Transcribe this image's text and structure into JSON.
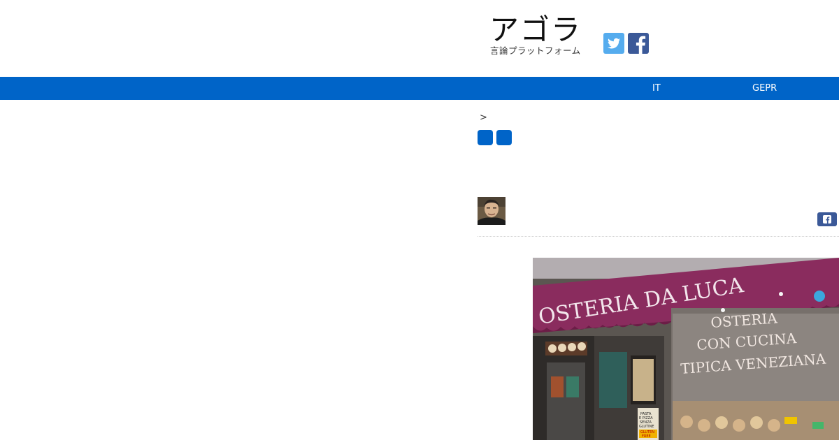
{
  "header": {
    "logo_title": "アゴラ",
    "logo_subtitle": "言論プラットフォーム",
    "social": [
      {
        "icon": "twitter-icon"
      },
      {
        "icon": "facebook-icon"
      }
    ]
  },
  "nav": {
    "items": [
      {
        "label": "IT"
      },
      {
        "label": "GEPR"
      }
    ]
  },
  "content": {
    "breadcrumb_separator": ">",
    "article_image": {
      "sign_awning": "OSTERIA DA LUCA",
      "window_line1": "OSTERIA",
      "window_line2": "CON CUCINA",
      "window_line3": "TIPICA VENEZIANA",
      "poster_line1": "PASTA",
      "poster_line2": "E PIZZA",
      "poster_line3": "SENZA",
      "poster_line4": "GLUTINE",
      "poster_line5": "GLUTEN",
      "poster_line6": "FREE"
    }
  },
  "colors": {
    "nav_bg": "#0064c8",
    "twitter": "#55acee",
    "facebook": "#3b5998",
    "awning": "#8a2c5e"
  }
}
